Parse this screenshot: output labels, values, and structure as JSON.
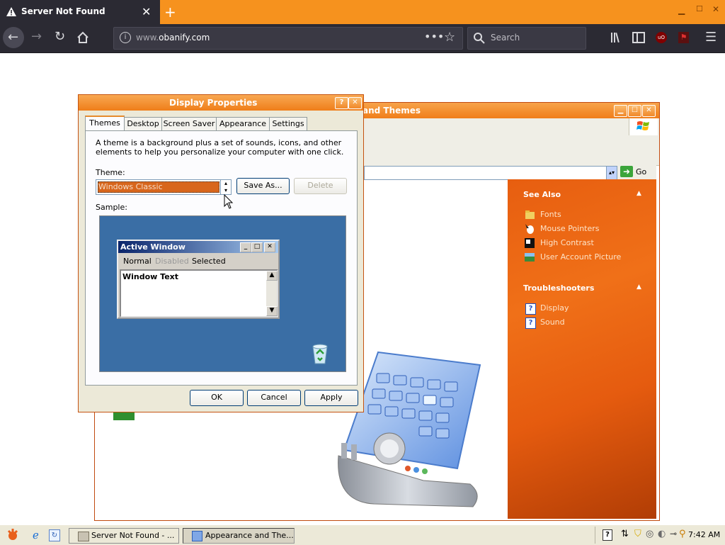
{
  "browser": {
    "tab_title": "Server Not Found",
    "url_prefix": "www.",
    "url_host": "obanify.com",
    "search_placeholder": "Search"
  },
  "appearance_window": {
    "title": "and Themes",
    "go_label": "Go",
    "see_also": {
      "heading": "See Also",
      "items": [
        "Fonts",
        "Mouse Pointers",
        "High Contrast",
        "User Account Picture"
      ]
    },
    "troubleshooters": {
      "heading": "Troubleshooters",
      "items": [
        "Display",
        "Sound"
      ]
    }
  },
  "dialog": {
    "title": "Display Properties",
    "help_glyph": "?",
    "tabs": [
      "Themes",
      "Desktop",
      "Screen Saver",
      "Appearance",
      "Settings"
    ],
    "description": "A theme is a background plus a set of sounds, icons, and other elements to help you personalize your computer with one click.",
    "theme_label": "Theme:",
    "theme_value": "Windows Classic",
    "save_as_label": "Save As...",
    "delete_label": "Delete",
    "sample_label": "Sample:",
    "preview": {
      "title": "Active Window",
      "menu": [
        "Normal",
        "Disabled",
        "Selected"
      ],
      "body_text": "Window Text"
    },
    "ok_label": "OK",
    "cancel_label": "Cancel",
    "apply_label": "Apply"
  },
  "taskbar": {
    "tasks": [
      "Server Not Found - ...",
      "Appearance and The..."
    ],
    "clock": "7:42 AM"
  },
  "colors": {
    "firefox_dark": "#2b2a33",
    "firefox_orange": "#f6921e",
    "xp_orange_title": "#f07e1a",
    "side_panel": "#e75e10",
    "sample_desktop": "#3a6ea5"
  }
}
